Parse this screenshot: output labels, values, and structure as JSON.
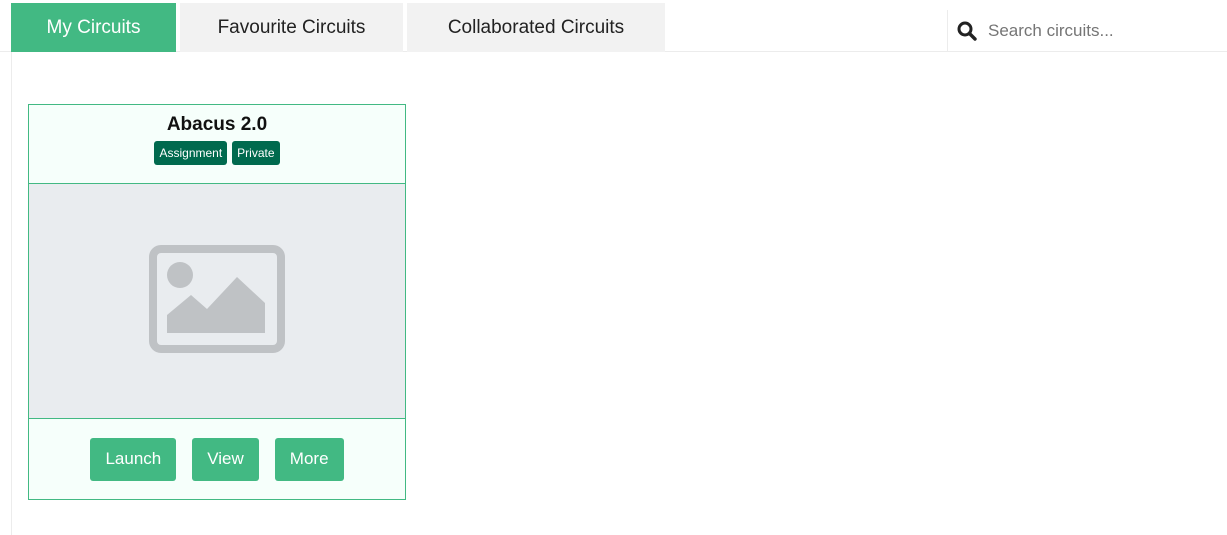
{
  "tabs": [
    {
      "label": "My Circuits",
      "active": true
    },
    {
      "label": "Favourite Circuits",
      "active": false
    },
    {
      "label": "Collaborated Circuits",
      "active": false
    }
  ],
  "search": {
    "placeholder": "Search circuits...",
    "value": "",
    "icon": "search-icon"
  },
  "circuits": [
    {
      "title": "Abacus 2.0",
      "badges": [
        "Assignment",
        "Private"
      ],
      "thumbnail_icon": "image-placeholder-icon",
      "actions": {
        "launch": "Launch",
        "view": "View",
        "more": "More"
      }
    }
  ],
  "colors": {
    "accent": "#42b983",
    "badge": "#006a4e",
    "tab_inactive": "#f2f2f2",
    "placeholder_bg": "#e9ecef",
    "placeholder_icon": "#bfc2c5"
  }
}
